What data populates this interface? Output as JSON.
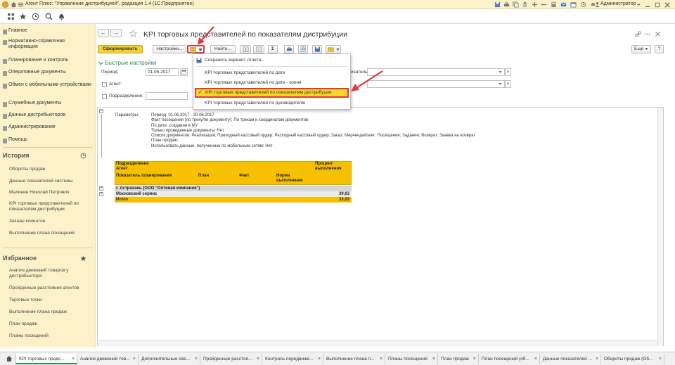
{
  "window": {
    "title": "Агент Плюс: \"Управление дистрибуцией\", редакция 1.4  (1С:Предприятие)",
    "user": "Администратор"
  },
  "sidebar": {
    "sections": [
      {
        "label": "Главное"
      },
      {
        "label": "Нормативно-справочная информация"
      },
      {
        "label": "Планирование и контроль"
      },
      {
        "label": "Оперативные документы"
      },
      {
        "label": "Обмен с мобильными устройствами"
      },
      {
        "label": "Служебные документы"
      },
      {
        "label": "Данные дистрибьюторов"
      },
      {
        "label": "Администрирование"
      },
      {
        "label": "Помощь"
      }
    ],
    "history": {
      "title": "История",
      "items": [
        "Обороты продаж",
        "Данные показателей системы",
        "Малинин Николай Петрович",
        "KPI торговых представителей по показателям дистрибуции",
        "Заказы клиентов",
        "Выполнение плана посещений"
      ]
    },
    "favorites": {
      "title": "Избранное",
      "items": [
        "Анализ движений товаров у дистрибьютора",
        "Пройденные расстояния агентов",
        "Торговые точки",
        "Выполнение плана продаж",
        "План продаж",
        "Планы посещений"
      ]
    }
  },
  "main": {
    "title": "KPI торговых представителей по показателям дистрибуции",
    "toolbar": {
      "generate": "Сформировать",
      "settings": "Настройки...",
      "find": "Найти...",
      "sum": "Σ",
      "more": "Еще",
      "help": "?"
    },
    "quick_settings": "Быстрые настройки",
    "filters": {
      "period_label": "Период:",
      "period_value": "01.06.2017",
      "agent_label": "Агент:",
      "subdivision_label": "Подразделение:",
      "right_label": "изатель:"
    },
    "menu": {
      "items": [
        "Сохранить вариант отчета...",
        "KPI торговых представителей по дате",
        "KPI торговых представителей по дате - копия",
        "KPI торговых представителей по показателям дистрибуции",
        "KPI торговых представителей по руководителю"
      ]
    }
  },
  "report": {
    "params_label": "Параметры:",
    "params": [
      "Период: 01.06.2017 - 30.06.2017",
      "Факт посещения (по треку/по документу): По трекам и координатам документов",
      "По дате: создания в МУ",
      "Только проведенные документы: Нет",
      "Список документов: Реализация; Приходный кассовый ордер; Расходный кассовый ордер; Заказ; Мерчендайзинг; Посещение; Задание; Возврат; Заявка на возврат",
      "План продаж:",
      "Использовать данные, полученные по мобильным сетям: Нет"
    ],
    "table": {
      "h_subdivision": "Подразделение",
      "h_agent": "Агент",
      "h_indicator": "Показатель планирования",
      "h_plan": "План",
      "h_fact": "Факт",
      "h_norm": "Норма выполнения",
      "h_percent": "Процент выполнения",
      "row_city": "г. Астрахань (ООО \"Оптовая компания\")",
      "row_agent": "Московский сервис",
      "row_agent_value": "39,63",
      "row_total": "Итого",
      "row_total_value": "33,03"
    }
  },
  "tabs": [
    {
      "label": "KPI торговых предс..."
    },
    {
      "label": "Анализ движений тов..."
    },
    {
      "label": "Дополнительные све..."
    },
    {
      "label": "Пройденные расстоя..."
    },
    {
      "label": "Контроль передвиже..."
    },
    {
      "label": "Выполнение плана п..."
    },
    {
      "label": "Планы посещений"
    },
    {
      "label": "План продаж"
    },
    {
      "label": "План посещений (об..."
    },
    {
      "label": "Данные показателей ..."
    },
    {
      "label": "Обороты продаж (Об..."
    }
  ],
  "colors": {
    "accent": "#f5d12d",
    "highlight": "#e2383c",
    "table_header": "#f7c000",
    "sidebar": "#fbf2c9"
  }
}
